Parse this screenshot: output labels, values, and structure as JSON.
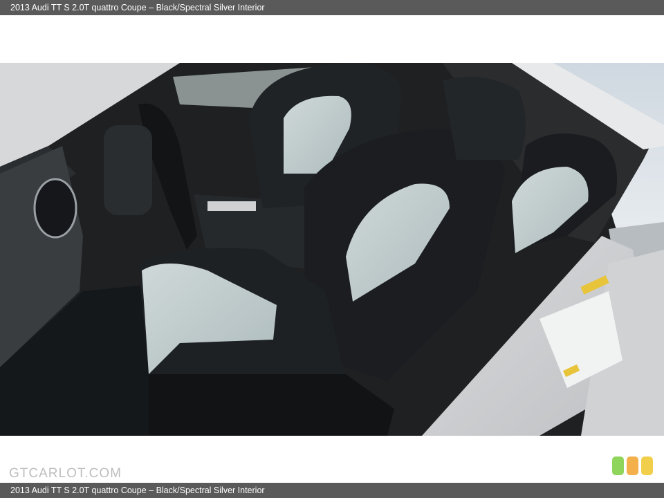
{
  "header": {
    "title": "2013 Audi TT S 2.0T quattro Coupe – Black/Spectral Silver Interior"
  },
  "footer": {
    "title": "2013 Audi TT S 2.0T quattro Coupe – Black/Spectral Silver Interior"
  },
  "watermark": {
    "text": "GTCARLOT.COM"
  },
  "badge": {
    "colors": [
      "#8fd45b",
      "#f4b04a",
      "#f2cf4b"
    ]
  },
  "photo": {
    "alt": "2013 Audi TT S 2.0T quattro Coupe – Black/Spectral Silver Interior"
  }
}
